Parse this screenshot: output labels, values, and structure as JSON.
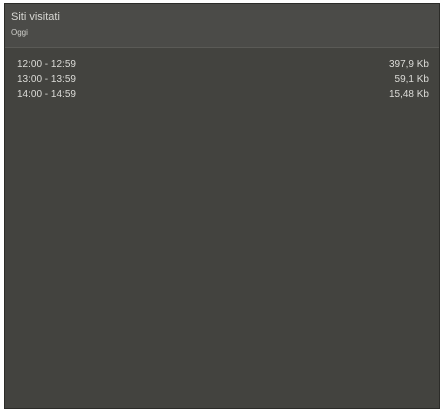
{
  "header": {
    "title": "Siti visitati",
    "subtitle": "Oggi"
  },
  "rows": [
    {
      "time_range": "12:00 - 12:59",
      "size": "397,9 Kb"
    },
    {
      "time_range": "13:00 - 13:59",
      "size": "59,1 Kb"
    },
    {
      "time_range": "14:00 - 14:59",
      "size": "15,48 Kb"
    }
  ]
}
